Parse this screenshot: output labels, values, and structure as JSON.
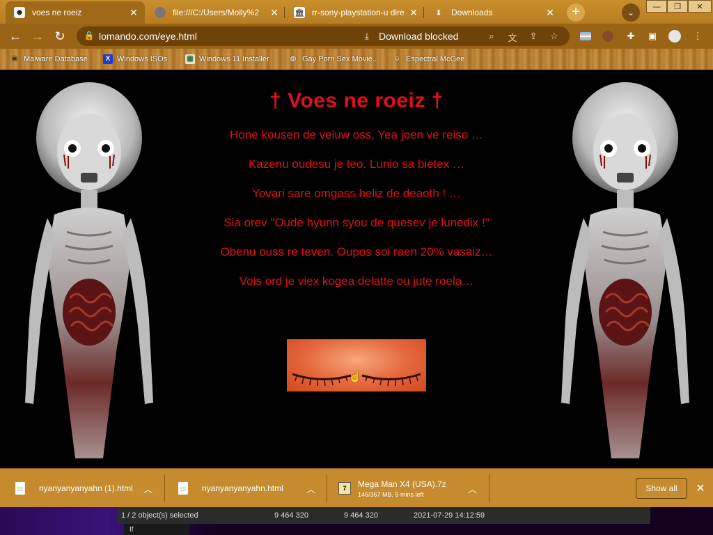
{
  "tabs": [
    {
      "title": "voes ne roeiz",
      "active": true
    },
    {
      "title": "file:///C:/Users/Molly%2",
      "active": false
    },
    {
      "title": "rr-sony-playstation-u dire",
      "active": false
    },
    {
      "title": "Downloads",
      "active": false
    }
  ],
  "window_controls": {
    "minimize": "—",
    "restore": "❐",
    "close": "✕"
  },
  "toolbar": {
    "url": "lomando.com/eye.html",
    "download_blocked": "Download blocked"
  },
  "bookmarks": [
    {
      "label": "Malware Database",
      "icon": "skull-icon"
    },
    {
      "label": "Windows ISOs",
      "icon": "x-icon"
    },
    {
      "label": "Windows 11 Installer",
      "icon": "image-icon"
    },
    {
      "label": "Gay Porn Sex Movie...",
      "icon": "globe-icon"
    },
    {
      "label": "Espectral McGee",
      "icon": "ghost-icon"
    }
  ],
  "page": {
    "heading": "† Voes ne roeiz †",
    "lines": [
      "Hone kousen de veiuw oss, Yea joen ve reiso …",
      "Kazenu oudesu je teo. Lunio sa bietex …",
      "Yovari sare omgass heliz de deaoth ! …",
      "Sia orev \"Oude hyunn syou de quesev je lunedix !\"",
      "Obenu ouss re teven. Oupos soi raen 20% vasaiz…",
      "Vois ord je viex kogea delatte ou jute roela…"
    ]
  },
  "downloads": [
    {
      "name": "nyanyanyanyahn (1).html",
      "status": ""
    },
    {
      "name": "nyanyanyanyahn.html",
      "status": ""
    },
    {
      "name": "Mega Man X4 (USA).7z",
      "status": "146/367 MB, 5 mins left"
    }
  ],
  "shelf": {
    "show_all": "Show all"
  },
  "explorer": {
    "selection": "1 / 2 object(s) selected",
    "size1": "9 464 320",
    "size2": "9 464 320",
    "date": "2021-07-29 14:12:59",
    "lower": "If"
  },
  "colors": {
    "accent_red": "#e0101a",
    "chrome_brown": "#9a6416",
    "shelf_brown": "#c58b2e"
  }
}
